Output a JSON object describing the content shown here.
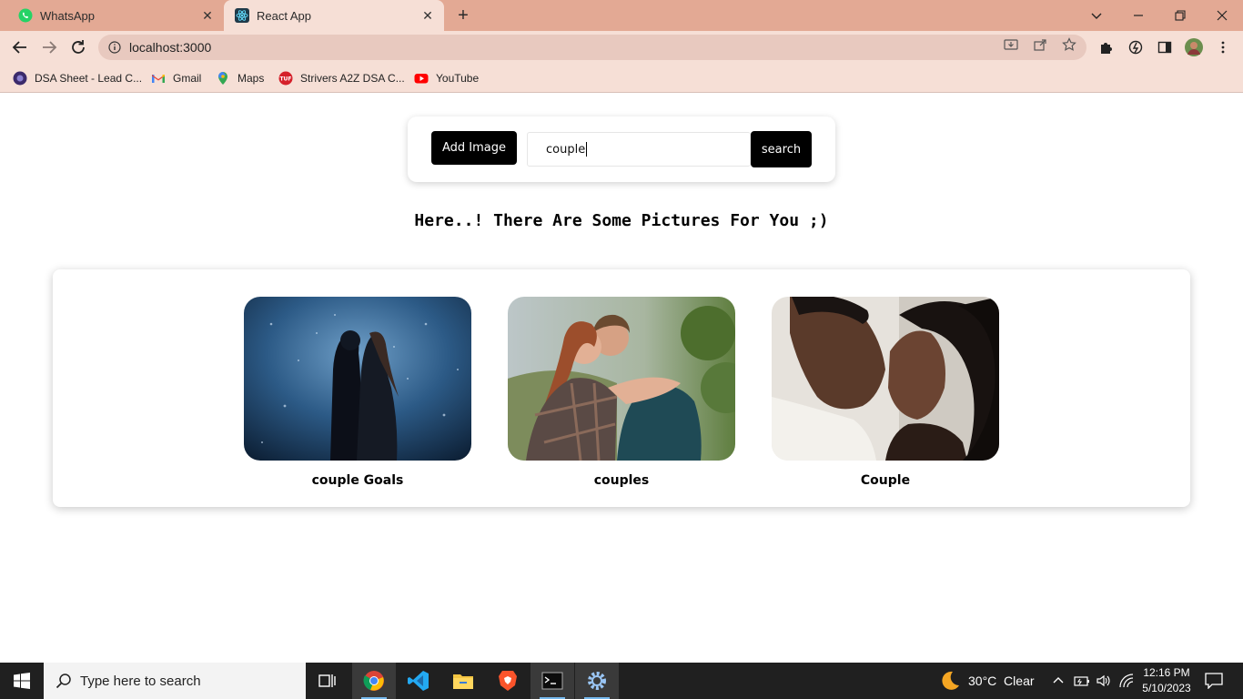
{
  "browser": {
    "tabs": [
      {
        "title": "WhatsApp",
        "icon": "whatsapp-icon",
        "active": false
      },
      {
        "title": "React App",
        "icon": "react-icon",
        "active": true
      }
    ],
    "url": "localhost:3000",
    "bookmarks": [
      {
        "label": "DSA Sheet - Lead C...",
        "icon": "dsa-sheet-icon"
      },
      {
        "label": "Gmail",
        "icon": "gmail-icon"
      },
      {
        "label": "Maps",
        "icon": "maps-icon"
      },
      {
        "label": "Strivers A2Z DSA C...",
        "icon": "tuf-icon"
      },
      {
        "label": "YouTube",
        "icon": "youtube-icon"
      }
    ]
  },
  "search": {
    "add_label": "Add Image",
    "query": "couple",
    "button_label": "search"
  },
  "heading": "Here..! There Are Some Pictures For You ;)",
  "gallery": [
    {
      "caption": "couple Goals"
    },
    {
      "caption": "couples"
    },
    {
      "caption": "Couple"
    }
  ],
  "taskbar": {
    "search_placeholder": "Type here to search",
    "weather": "30°C  Clear",
    "time": "12:16 PM",
    "date": "5/10/2023"
  },
  "colors": {
    "tabbar": "#e3a994",
    "toolbar": "#f6dfd6",
    "button": "#000000",
    "taskbar": "#202020"
  }
}
